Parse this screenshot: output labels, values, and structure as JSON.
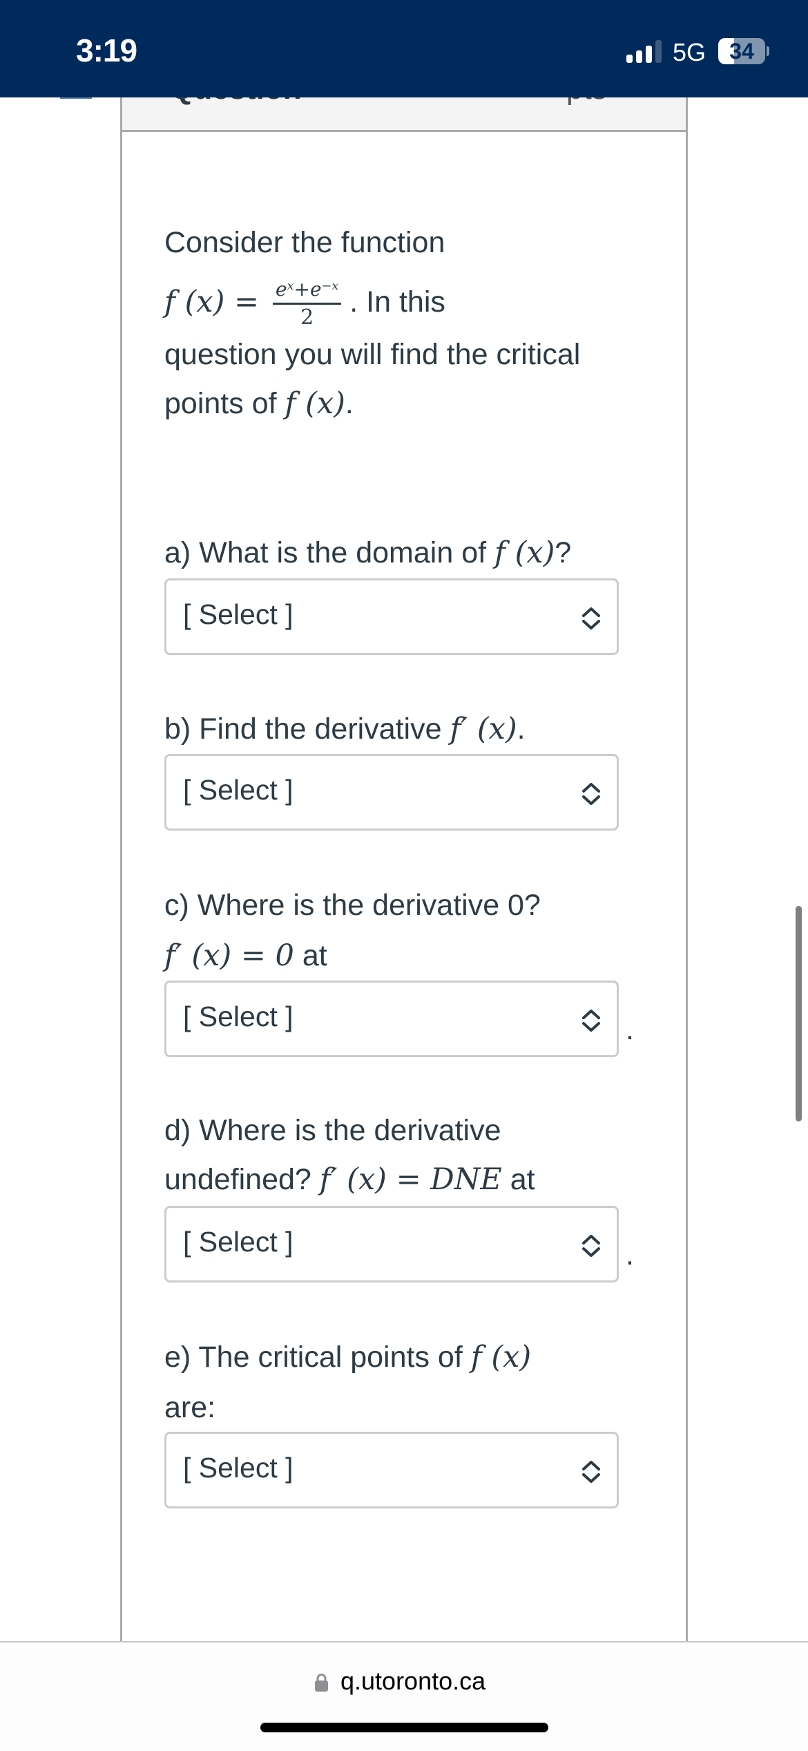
{
  "status_bar": {
    "time": "3:19",
    "network": "5G",
    "battery_percent": 34,
    "battery_label": "34",
    "signal_bars_active": 3,
    "signal_bars_total": 4,
    "background_color": "#002a5c"
  },
  "question_header": {
    "title": "Question",
    "points": "pts"
  },
  "question": {
    "intro_line1": "Consider the function",
    "func_lhs": "f (x) =",
    "func_numerator": "eˣ+e⁻ˣ",
    "func_denominator": "2",
    "intro_after_func": ". In this",
    "intro_line3": "question you will find the critical",
    "intro_line4_prefix": "points of",
    "intro_line4_math": "f (x)",
    "intro_line4_suffix": "."
  },
  "parts": [
    {
      "label": "a) What is the domain of",
      "math": "f (x)",
      "suffix": "?",
      "select": {
        "value": "[ Select ]"
      }
    },
    {
      "label": "b) Find the derivative",
      "math": "f′ (x)",
      "suffix": ".",
      "select": {
        "value": "[ Select ]"
      }
    },
    {
      "label": "c) Where is the derivative 0?",
      "line2_math": "f′ (x) = 0",
      "line2_suffix": "at",
      "select": {
        "value": "[ Select ]"
      },
      "after_select": "."
    },
    {
      "label": "d) Where is the derivative",
      "line2_prefix": "undefined?",
      "line2_math": "f′ (x) = DNE",
      "line2_suffix": "at",
      "select": {
        "value": "[ Select ]"
      },
      "after_select": "."
    },
    {
      "label": "e) The critical points of",
      "math": "f (x)",
      "line2": "are:",
      "select": {
        "value": "[ Select ]"
      }
    }
  ],
  "browser": {
    "url": "q.utoronto.ca",
    "lock_icon": "lock-icon"
  },
  "colors": {
    "text": "#2d3b45",
    "border": "#aaaaaa",
    "select_border": "#cccccc",
    "header_fill": "#f4f4f4"
  }
}
